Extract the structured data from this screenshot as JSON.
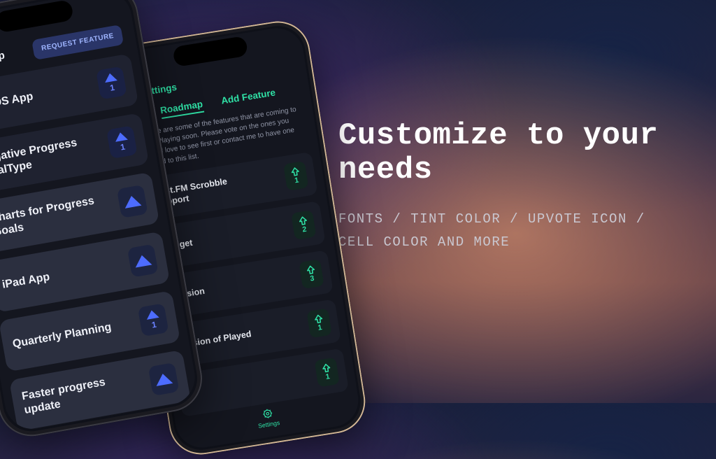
{
  "marketing": {
    "heading": "Customize to your needs",
    "subheading": "Fonts / Tint Color / Upvote Icon / Cell Color and more"
  },
  "front_phone": {
    "tab": "Roadmap",
    "request_button": "Request Feature",
    "items": [
      {
        "title": "macOS App",
        "votes": "1"
      },
      {
        "title": "Negative Progress GoalType",
        "votes": "1"
      },
      {
        "title": "Charts for Progress Goals",
        "votes": ""
      },
      {
        "title": "iPad App",
        "votes": ""
      },
      {
        "title": "Quarterly Planning",
        "votes": "1"
      },
      {
        "title": "Faster progress update",
        "votes": ""
      }
    ]
  },
  "back_phone": {
    "back_label": "Settings",
    "tabs": {
      "roadmap": "Roadmap",
      "add": "Add Feature"
    },
    "description": "These are some of the features that are coming to NowPlaying soon. Please vote on the ones you would love to see first or contact me to have one added to this list.",
    "items": [
      {
        "title": "Last.FM Scrobble support",
        "votes": "1"
      },
      {
        "title": "Widget",
        "votes": "2"
      },
      {
        "title": "Session",
        "votes": "3"
      },
      {
        "title": "Version of Played",
        "votes": "1"
      },
      {
        "title": "",
        "votes": "1"
      }
    ],
    "tabbar": {
      "settings": "Settings"
    }
  }
}
